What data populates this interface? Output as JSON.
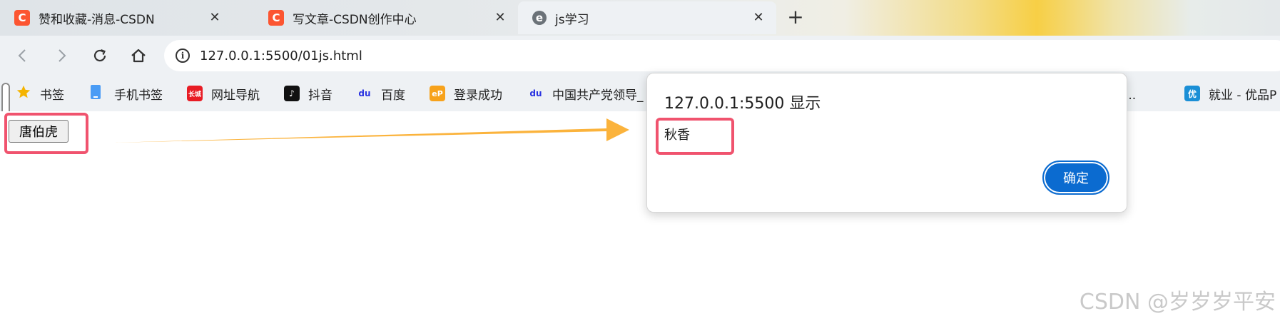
{
  "browser": {
    "tabs": [
      {
        "title": "赞和收藏-消息-CSDN",
        "favicon": "C"
      },
      {
        "title": "写文章-CSDN创作中心",
        "favicon": "C"
      },
      {
        "title": "js学习",
        "favicon": "e"
      }
    ],
    "address_bar": {
      "url": "127.0.0.1:5500/01js.html"
    },
    "bookmarks": [
      {
        "label": "书签",
        "icon": "star-icon",
        "color": "#f5b400"
      },
      {
        "label": "手机书签",
        "icon": "phone-icon",
        "color": "#4a9cf5"
      },
      {
        "label": "网址导航",
        "icon": "nav-icon",
        "color": "#e81c24",
        "glyph": "长城"
      },
      {
        "label": "抖音",
        "icon": "douyin-icon",
        "color": "#111111",
        "glyph": "♪"
      },
      {
        "label": "百度",
        "icon": "baidu-icon",
        "color": "#2932e1",
        "glyph": "du"
      },
      {
        "label": "登录成功",
        "icon": "ep-icon",
        "color": "#f7a21b",
        "glyph": "eP"
      },
      {
        "label": "中国共产党领导_",
        "icon": "baidu-icon",
        "color": "#2932e1",
        "glyph": "du"
      },
      {
        "label": "模版...",
        "icon": "",
        "color": ""
      },
      {
        "label": "就业 - 优品P",
        "icon": "youpin-icon",
        "color": "#1a8fd6",
        "glyph": "优"
      }
    ]
  },
  "page": {
    "button_label": "唐伯虎"
  },
  "dialog": {
    "title": "127.0.0.1:5500 显示",
    "message": "秋香",
    "ok_label": "确定"
  },
  "watermark": "CSDN @岁岁岁平安",
  "colors": {
    "highlight": "#f0536e",
    "arrow": "#fbb33c",
    "ok_button": "#0b6bd0",
    "csdn": "#fc5531"
  }
}
